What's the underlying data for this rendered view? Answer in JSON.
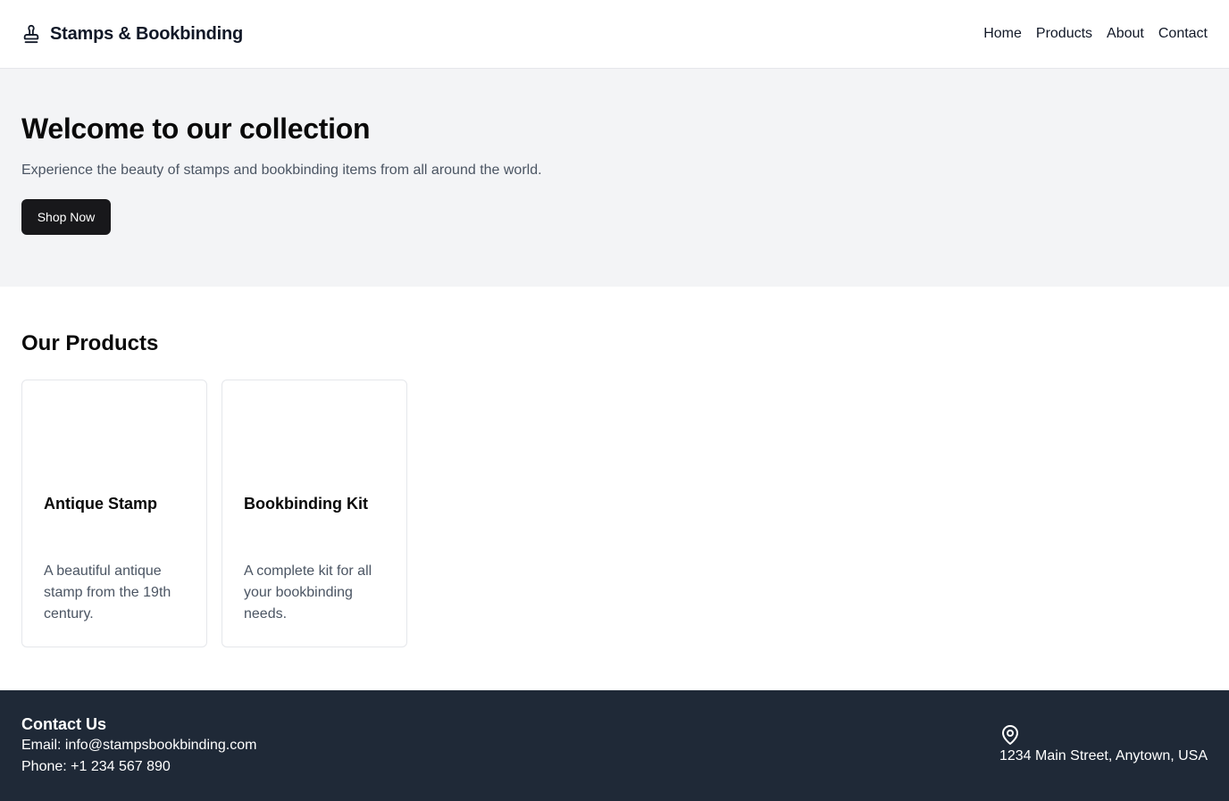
{
  "header": {
    "brand": "Stamps & Bookbinding",
    "brand_icon": "stamp-icon",
    "nav": [
      "Home",
      "Products",
      "About",
      "Contact"
    ]
  },
  "hero": {
    "title": "Welcome to our collection",
    "subtitle": "Experience the beauty of stamps and bookbinding items from all around the world.",
    "cta": "Shop Now"
  },
  "products": {
    "heading": "Our Products",
    "items": [
      {
        "title": "Antique Stamp",
        "description": "A beautiful antique stamp from the 19th century."
      },
      {
        "title": "Bookbinding Kit",
        "description": "A complete kit for all your bookbinding needs."
      }
    ]
  },
  "footer": {
    "heading": "Contact Us",
    "email": "Email: info@stampsbookbinding.com",
    "phone": "Phone: +1 234 567 890",
    "address_icon": "map-pin-icon",
    "address": "1234 Main Street, Anytown, USA"
  },
  "colors": {
    "header_bg": "#ffffff",
    "hero_bg": "#f3f4f6",
    "primary_button": "#18181b",
    "footer_bg": "#1f2937",
    "muted_text": "#4b5563"
  }
}
